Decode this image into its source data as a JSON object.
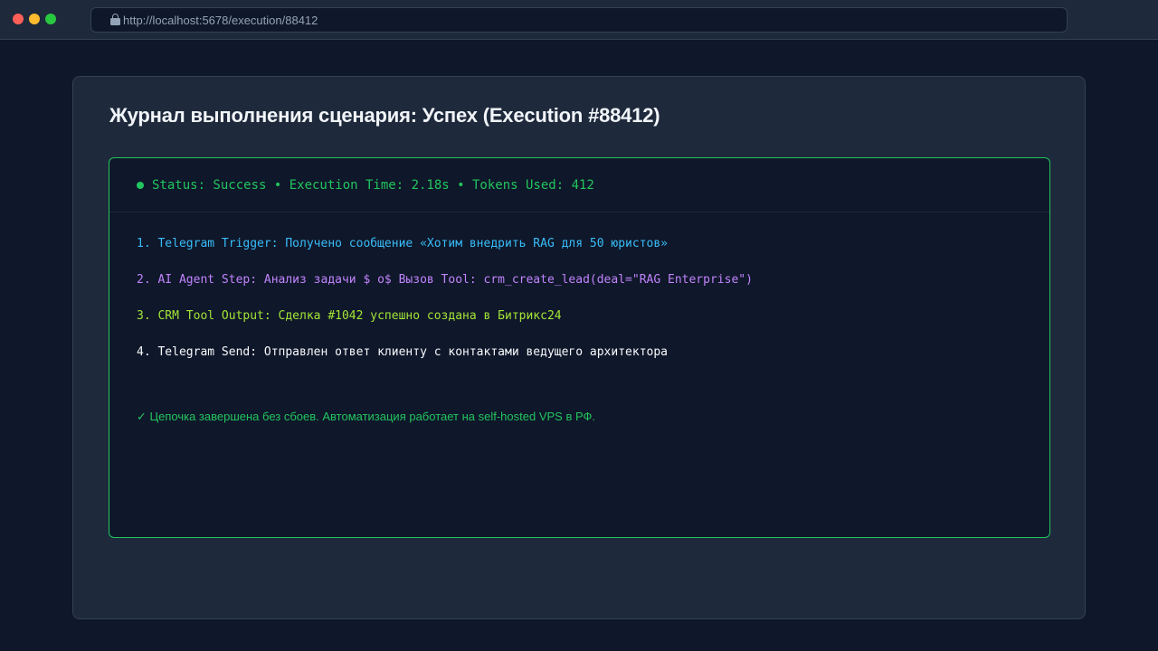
{
  "browser": {
    "url": "http://localhost:5678/execution/88412"
  },
  "page": {
    "title": "Журнал выполнения сценария: Успех (Execution #88412)"
  },
  "console": {
    "status_line": "Status: Success • Execution Time: 2.18s • Tokens Used: 412",
    "lines": [
      "1. Telegram Trigger: Получено сообщение «Хотим внедрить RAG для 50 юристов»",
      "2. AI Agent Step: Анализ задачи $ o$ Вызов Tool: crm_create_lead(deal=\"RAG Enterprise\")",
      "3. CRM Tool Output: Сделка #1042 успешно создана в Битрикс24",
      "4. Telegram Send: Отправлен ответ клиенту с контактами ведущего архитектора"
    ],
    "footer": "✓ Цепочка завершена без сбоев. Автоматизация работает на self-hosted VPS в РФ."
  },
  "colors": {
    "success": "#22c55e",
    "trigger": "#38bdf8",
    "agent": "#c084fc",
    "tool": "#a3e635",
    "send": "#f8fafc"
  }
}
